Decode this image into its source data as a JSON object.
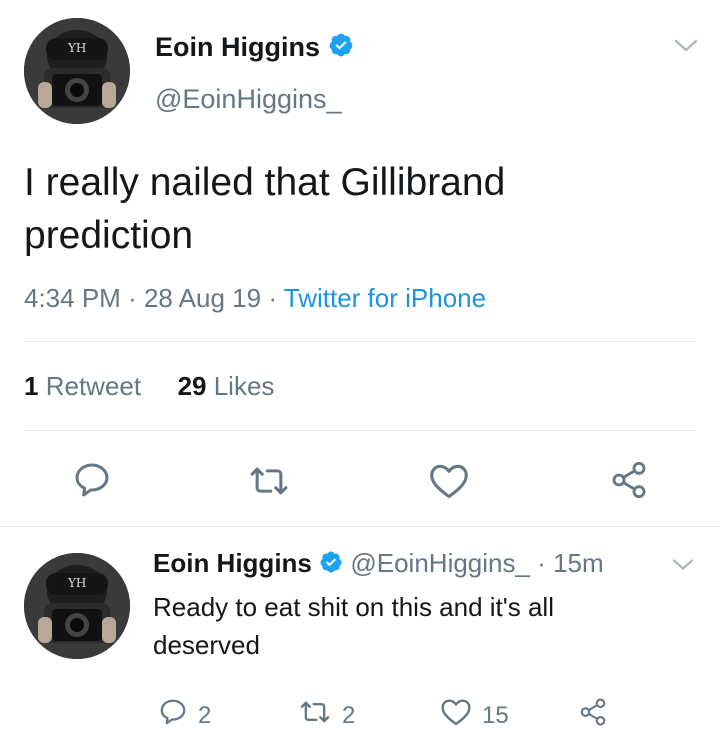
{
  "tweet": {
    "author_name": "Eoin Higgins",
    "author_handle": "@EoinHiggins_",
    "text": "I really nailed that Gillibrand prediction",
    "time": "4:34 PM",
    "date": "28 Aug 19",
    "source": "Twitter for iPhone",
    "sep": "·",
    "retweet_count": "1",
    "retweet_label": "Retweet",
    "like_count": "29",
    "like_label": "Likes"
  },
  "reply": {
    "author_name": "Eoin Higgins",
    "author_handle": "@EoinHiggins_",
    "time_ago": "· 15m",
    "text": "Ready to eat shit on this and it's all deserved",
    "reply_count": "2",
    "retweet_count": "2",
    "like_count": "15"
  },
  "colors": {
    "text": "#14171a",
    "secondary": "#657786",
    "link": "#1b95e0",
    "verified": "#1da1f2",
    "divider": "#e1e8ed"
  }
}
